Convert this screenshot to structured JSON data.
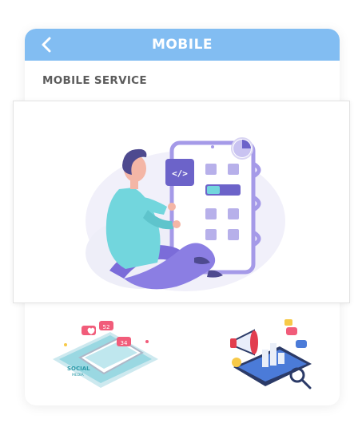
{
  "header": {
    "title": "MOBILE",
    "back_icon": "chevron-left-icon"
  },
  "section": {
    "title": "MOBILE SERVICE"
  },
  "illustrations": {
    "main": "mobile-developer-illustration",
    "code_glyph": "</>",
    "thumb_social_text_1": "SOCIAL",
    "thumb_social_text_2": "MEDIA",
    "thumb_social_badges": [
      "52",
      "34"
    ],
    "thumb_marketing": "digital-marketing-illustration"
  },
  "colors": {
    "accent": "#82bdf2",
    "purple": "#7b6cd9",
    "teal": "#72d6dd"
  }
}
